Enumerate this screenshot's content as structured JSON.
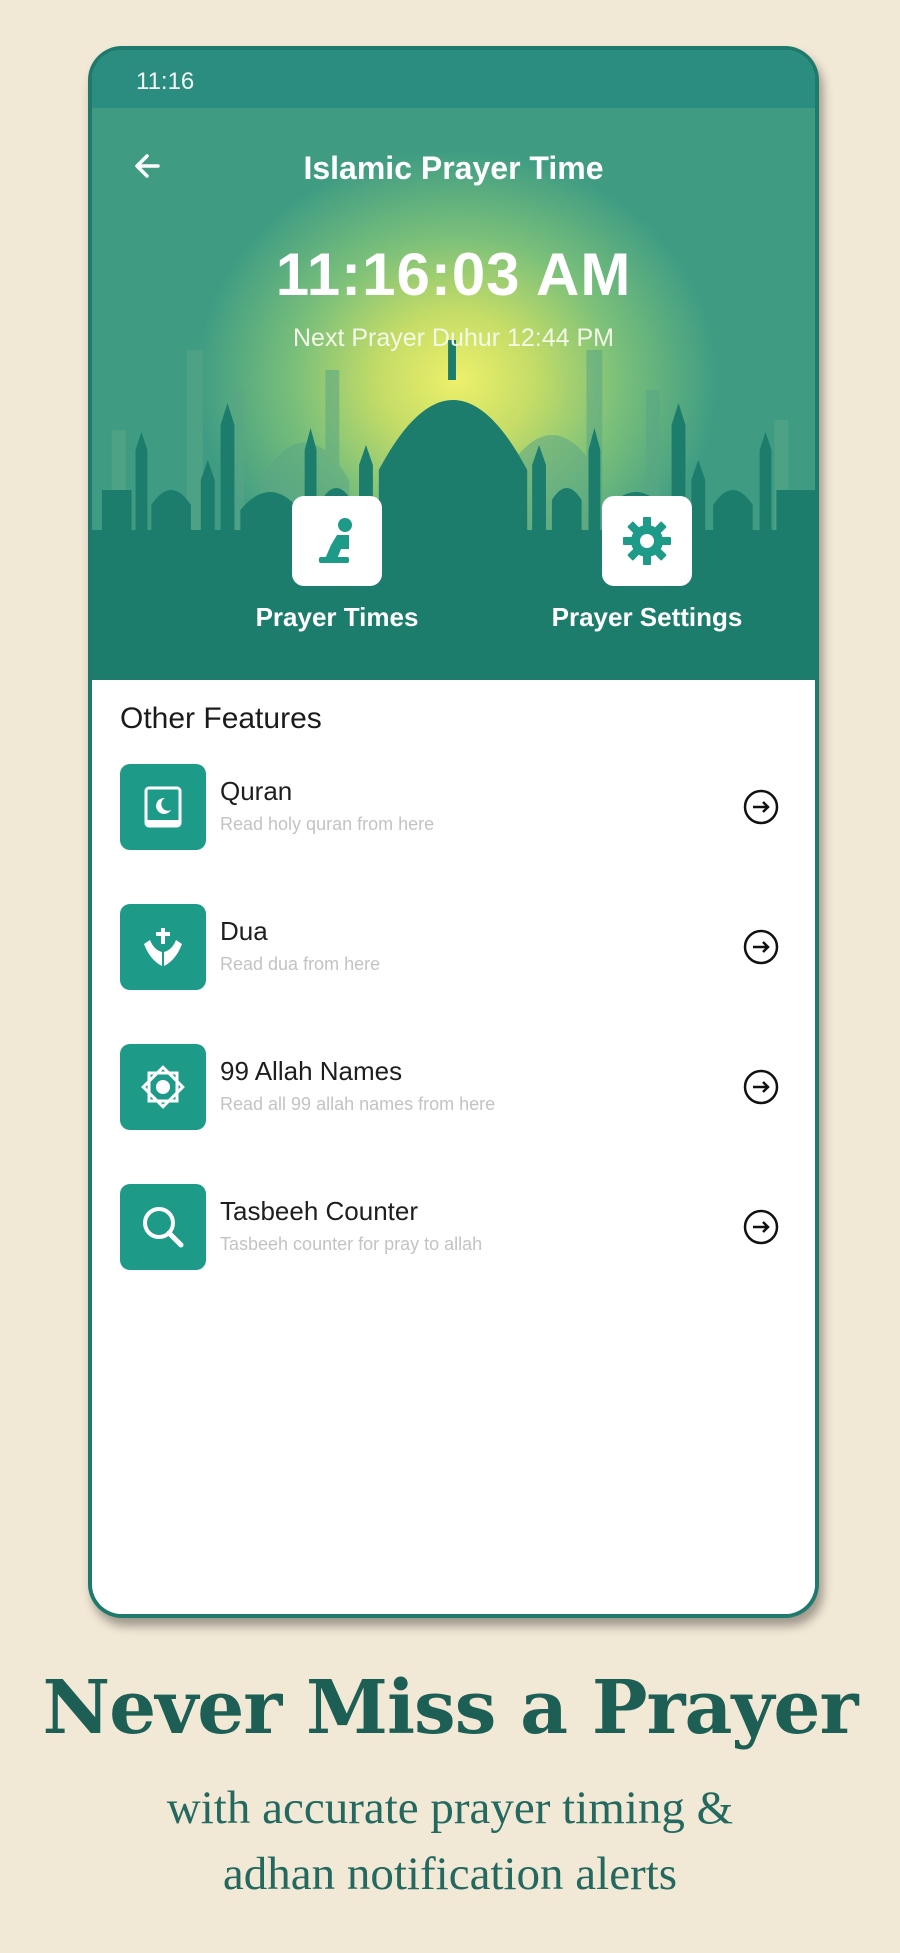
{
  "status_bar": {
    "time": "11:16"
  },
  "header": {
    "title": "Islamic Prayer Time",
    "clock": "11:16:03 AM",
    "next_prayer": "Next Prayer Duhur 12:44 PM"
  },
  "actions": [
    {
      "label": "Prayer Times",
      "icon": "praying-person-icon"
    },
    {
      "label": "Prayer Settings",
      "icon": "gear-icon"
    }
  ],
  "features": {
    "title": "Other Features",
    "items": [
      {
        "name": "Quran",
        "desc": "Read holy quran from here",
        "icon": "quran-book-icon"
      },
      {
        "name": "Dua",
        "desc": "Read dua from here",
        "icon": "praying-hands-icon"
      },
      {
        "name": "99 Allah Names",
        "desc": "Read all 99 allah names from here",
        "icon": "star-badge-icon"
      },
      {
        "name": "Tasbeeh Counter",
        "desc": "Tasbeeh counter for pray to allah",
        "icon": "tasbeeh-icon"
      }
    ]
  },
  "tagline": {
    "title": "Never Miss a Prayer",
    "line1": "with accurate prayer timing &",
    "line2": "adhan notification alerts"
  },
  "colors": {
    "accent": "#1d9b88",
    "header_dark": "#1a7c6c",
    "background": "#f2e8d6",
    "tagline": "#1d5e55"
  }
}
